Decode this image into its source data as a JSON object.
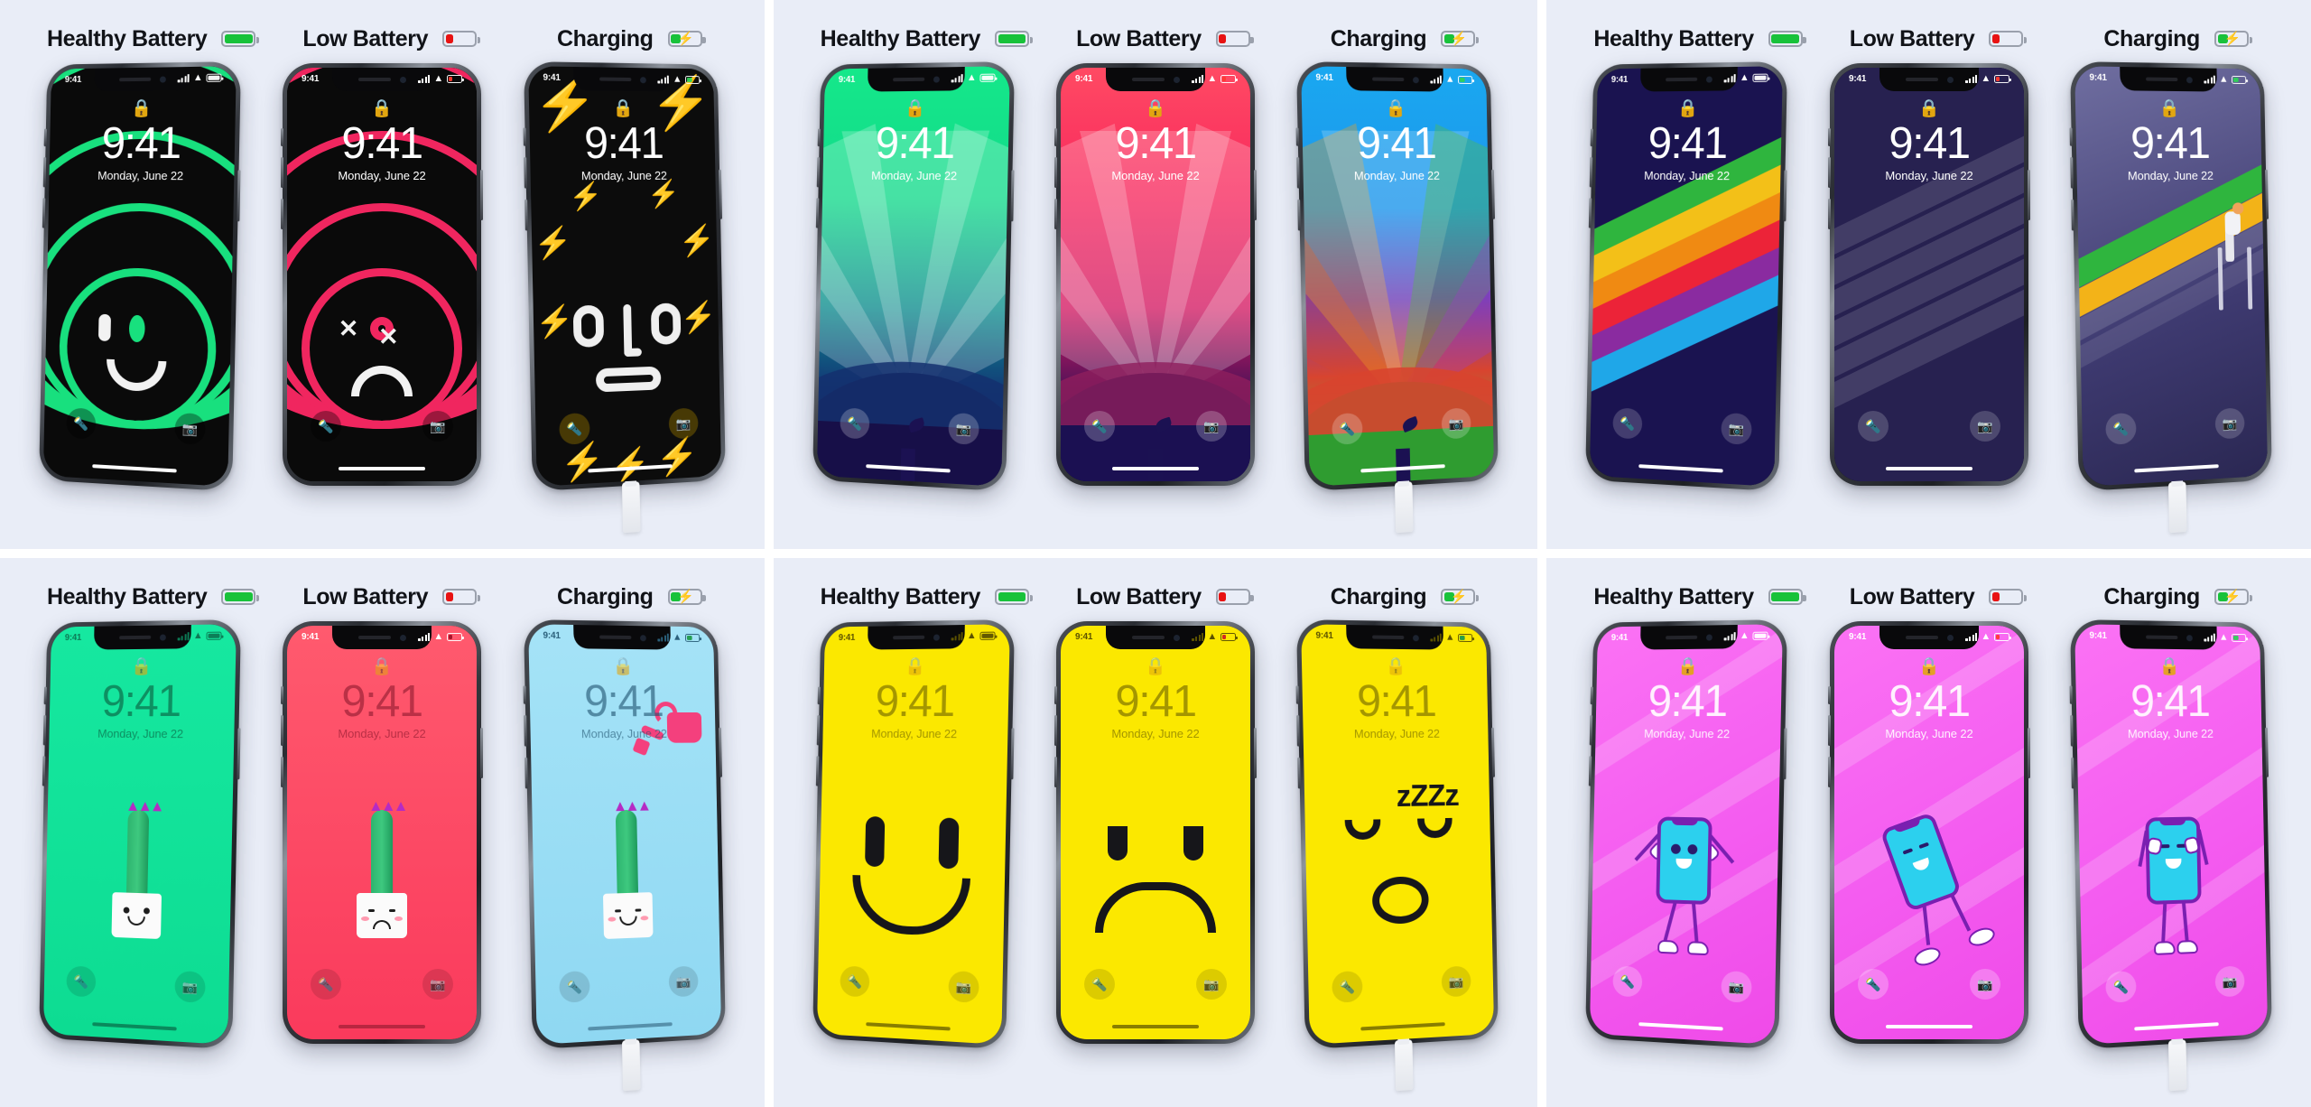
{
  "page": {
    "background": "#e9edf7",
    "gap_color": "#ffffff"
  },
  "headers": {
    "healthy": "Healthy Battery",
    "low": "Low Battery",
    "charging": "Charging",
    "icons": {
      "healthy": "battery-full-icon",
      "low": "battery-low-icon",
      "charging": "battery-charging-icon"
    },
    "colors": {
      "healthy_fill": "#18c23a",
      "low_fill": "#e81212",
      "charging_fill": "#18c23a",
      "outline": "#9aa0ac",
      "label": "#111318"
    }
  },
  "lockscreen": {
    "time": "9:41",
    "date": "Monday, June 22",
    "status_time": "9:41",
    "lock_icon": "lock-icon",
    "wifi_icon": "wifi-icon",
    "signal_icon": "cellular-signal-icon",
    "battery_icon": "status-battery-icon",
    "flashlight_icon": "flashlight-icon",
    "camera_icon": "camera-icon",
    "home_indicator": "home-indicator"
  },
  "panels": [
    {
      "id": "panel-rings",
      "name": "rings-faces-wallpapers",
      "phones": [
        {
          "state": "healthy",
          "wallpaper": "green-rings-smiley",
          "accent": "#18e07e",
          "bg": "#0a0a0a",
          "charging": false,
          "tilt": "tilt-r"
        },
        {
          "state": "low",
          "wallpaper": "pink-rings-frown",
          "accent": "#f0265f",
          "bg": "#0a0a0a",
          "charging": false,
          "tilt": "tilt-c"
        },
        {
          "state": "charging",
          "wallpaper": "yellow-bolts-ojo-face",
          "accent": "#f2c41a",
          "bg": "#0c0c0c",
          "charging": true,
          "tilt": "tilt-l"
        }
      ]
    },
    {
      "id": "panel-apple",
      "name": "apple-logo-gradient-wallpapers",
      "phones": [
        {
          "state": "healthy",
          "wallpaper": "green-apple-rays",
          "accent": "#15e88a",
          "charging": false,
          "tilt": "tilt-r"
        },
        {
          "state": "low",
          "wallpaper": "red-apple-rays",
          "accent": "#f8295e",
          "charging": false,
          "tilt": "tilt-c"
        },
        {
          "state": "charging",
          "wallpaper": "blue-apple-rays",
          "accent": "#1aa8f0",
          "charging": true,
          "tilt": "tilt-l"
        }
      ]
    },
    {
      "id": "panel-stripes",
      "name": "retro-stripe-wallpapers",
      "phones": [
        {
          "state": "healthy",
          "wallpaper": "rainbow-diagonal-stripes",
          "accent": "#1a1350",
          "charging": false,
          "tilt": "tilt-r"
        },
        {
          "state": "low",
          "wallpaper": "monochrome-diagonal-stripes",
          "accent": "#272150",
          "charging": false,
          "tilt": "tilt-c"
        },
        {
          "state": "charging",
          "wallpaper": "climber-painting-stripes",
          "accent": "#3e3a70",
          "charging": true,
          "tilt": "tilt-l"
        }
      ]
    },
    {
      "id": "panel-cactus",
      "name": "cactus-plant-wallpapers",
      "phones": [
        {
          "state": "healthy",
          "wallpaper": "green-happy-cactus",
          "accent": "#16e8a0",
          "charging": false,
          "tilt": "tilt-r"
        },
        {
          "state": "low",
          "wallpaper": "red-sad-cactus",
          "accent": "#fa3a5c",
          "charging": false,
          "tilt": "tilt-c"
        },
        {
          "state": "charging",
          "wallpaper": "blue-watering-cactus",
          "accent": "#8fd8f2",
          "charging": true,
          "tilt": "tilt-l"
        }
      ]
    },
    {
      "id": "panel-smiley",
      "name": "yellow-smiley-wallpapers",
      "phones": [
        {
          "state": "healthy",
          "wallpaper": "yellow-smiling-face",
          "accent": "#fbe800",
          "charging": false,
          "tilt": "tilt-r"
        },
        {
          "state": "low",
          "wallpaper": "yellow-frowning-face",
          "accent": "#fbe800",
          "charging": false,
          "tilt": "tilt-c"
        },
        {
          "state": "charging",
          "wallpaper": "yellow-sleeping-face",
          "accent": "#fbe800",
          "charging": true,
          "tilt": "tilt-l",
          "sleep_text": "zZZz"
        }
      ]
    },
    {
      "id": "panel-character",
      "name": "pink-phone-character-wallpapers",
      "phones": [
        {
          "state": "healthy",
          "wallpaper": "pink-dancing-phone-character",
          "accent": "#f45cf0",
          "charging": false,
          "tilt": "tilt-r"
        },
        {
          "state": "low",
          "wallpaper": "pink-sleeping-phone-character",
          "accent": "#f45cf0",
          "charging": false,
          "tilt": "tilt-c"
        },
        {
          "state": "charging",
          "wallpaper": "pink-resting-phone-character",
          "accent": "#f45cf0",
          "charging": true,
          "tilt": "tilt-l"
        }
      ]
    }
  ]
}
